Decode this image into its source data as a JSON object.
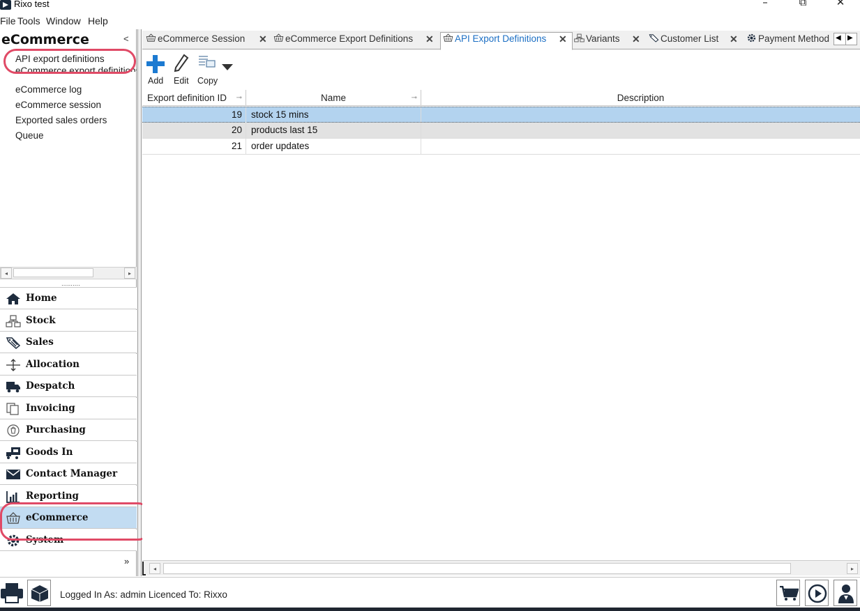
{
  "window": {
    "title": "Rixo test",
    "minimize_glyph": "–",
    "restore_glyph": "⧉",
    "close_glyph": "✕"
  },
  "menu": [
    "File",
    "Tools",
    "Window",
    "Help"
  ],
  "left_panel": {
    "title": "eCommerce",
    "collapse_glyph": "<",
    "links": [
      "API export definitions",
      "eCommerce export definitions",
      "eCommerce log",
      "eCommerce session",
      "Exported sales orders",
      "Queue"
    ],
    "grip": "‥‥‥‥‥",
    "modules": [
      {
        "label": "Home",
        "icon": "home-icon"
      },
      {
        "label": "Stock",
        "icon": "stock-icon"
      },
      {
        "label": "Sales",
        "icon": "sales-tag-icon"
      },
      {
        "label": "Allocation",
        "icon": "allocation-icon"
      },
      {
        "label": "Despatch",
        "icon": "truck-icon"
      },
      {
        "label": "Invoicing",
        "icon": "invoice-icon"
      },
      {
        "label": "Purchasing",
        "icon": "purchasing-icon"
      },
      {
        "label": "Goods In",
        "icon": "goods-in-icon"
      },
      {
        "label": "Contact Manager",
        "icon": "envelope-icon"
      },
      {
        "label": "Reporting",
        "icon": "bar-chart-icon"
      },
      {
        "label": "eCommerce",
        "icon": "basket-icon",
        "active": true
      },
      {
        "label": "System",
        "icon": "gear-icon"
      }
    ],
    "more_glyph": "»"
  },
  "tabs": [
    {
      "label": "eCommerce Session",
      "icon": "basket-icon"
    },
    {
      "label": "eCommerce Export Definitions",
      "icon": "basket-icon"
    },
    {
      "label": "API Export Definitions",
      "icon": "basket-icon",
      "active": true
    },
    {
      "label": "Variants",
      "icon": "stock-icon"
    },
    {
      "label": "Customer List",
      "icon": "sales-tag-icon"
    },
    {
      "label": "Payment Method",
      "icon": "gear-icon"
    }
  ],
  "tab_close_glyph": "✕",
  "toolbar": {
    "add": "Add",
    "edit": "Edit",
    "copy": "Copy"
  },
  "grid": {
    "columns": [
      "Export definition ID",
      "Name",
      "Description"
    ],
    "rows": [
      {
        "id": "19",
        "name": "stock 15 mins",
        "description": ""
      },
      {
        "id": "20",
        "name": "products last 15",
        "description": ""
      },
      {
        "id": "21",
        "name": "order updates",
        "description": ""
      }
    ],
    "selected_row": 0
  },
  "status": {
    "text": "Logged In As: admin  Licenced To: Rixxo"
  },
  "colors": {
    "accent": "#1c6fc4",
    "selection": "#b3d3ef",
    "annotation": "#e04a66",
    "active_module": "#c2dcf2"
  }
}
